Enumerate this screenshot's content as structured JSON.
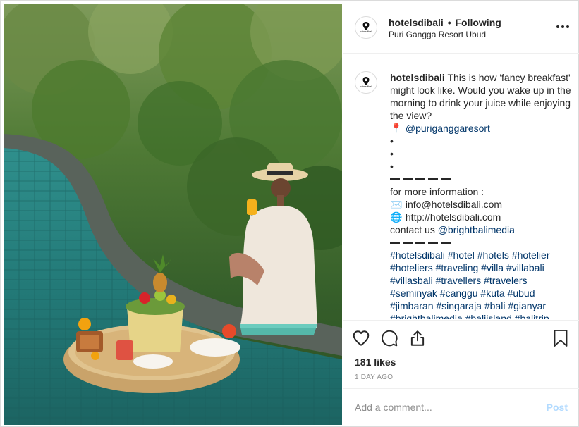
{
  "post": {
    "username": "hotelsdibali",
    "separator": "•",
    "follow_status": "Following",
    "location": "Puri Gangga Resort Ubud",
    "avatar_text": "hotelsdibali",
    "caption": {
      "username": "hotelsdibali",
      "text_lines": [
        "This is how 'fancy breakfast'",
        "might look like. Would you wake up in the",
        "morning to drink your juice while enjoying",
        "the view?"
      ],
      "location_emoji": "📍",
      "location_mention": "@puriganggaresort",
      "bullets": [
        "•",
        "•",
        "•"
      ],
      "info_label": "for more information :",
      "email_emoji": "✉️",
      "email": "info@hotelsdibali.com",
      "web_emoji": "🌐",
      "website": "http://hotelsdibali.com",
      "contact_label": "contact us",
      "contact_mention": "@brightbalimedia",
      "hashtag_lines": [
        "#hotelsdibali #hotel #hotels #hotelier",
        "#hoteliers #traveling #villa #villabali",
        "#villasbali #travellers #travelers",
        "#seminyak #canggu #kuta #ubud",
        "#jimbaran #singaraja #bali #gianyar",
        "#brightbalimedia #baliisland #balitrip"
      ]
    },
    "likes": "181 likes",
    "time_ago": "1 DAY AGO",
    "comment_placeholder": "Add a comment...",
    "post_button": "Post"
  },
  "icons": {
    "more": "more-options-icon",
    "like": "heart-icon",
    "comment": "comment-bubble-icon",
    "share": "share-upload-icon",
    "save": "bookmark-icon"
  },
  "colors": {
    "link": "#003569",
    "post_disabled": "#b3dbff",
    "muted": "#8e8e8e",
    "text": "#262626"
  }
}
